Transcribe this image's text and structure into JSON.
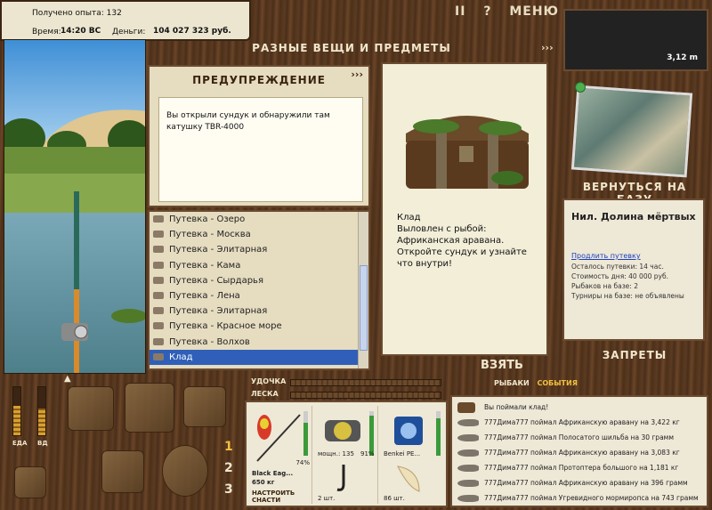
{
  "info": {
    "exp_label": "Получено опыта:",
    "exp_value": "132",
    "time_label": "Время:",
    "time_value": "14:20 ВС",
    "money_label": "Деньги:",
    "money_value": "104 027 323 руб."
  },
  "topbar": {
    "pause": "II",
    "help": "?",
    "menu": "МЕНЮ"
  },
  "depth": "3,12 m",
  "central": {
    "title": "РАЗНЫЕ ВЕЩИ И ПРЕДМЕТЫ",
    "arrows": "›››",
    "warning": {
      "title": "ПРЕДУПРЕЖДЕНИЕ",
      "arrows": "›››",
      "text": "Вы открыли сундук и обнаружили там катушку TBR-4000"
    },
    "list": [
      {
        "label": "Путевка - Озеро"
      },
      {
        "label": "Путевка - Москва"
      },
      {
        "label": "Путевка - Элитарная"
      },
      {
        "label": "Путевка - Кама"
      },
      {
        "label": "Путевка - Сырдарья"
      },
      {
        "label": "Путевка - Лена"
      },
      {
        "label": "Путевка - Элитарная"
      },
      {
        "label": "Путевка - Красное море"
      },
      {
        "label": "Путевка - Волхов"
      },
      {
        "label": "Клад"
      }
    ],
    "selected_index": 9,
    "detail": {
      "name": "Клад",
      "desc": "Выловлен с рыбой: Африканская аравана. Откройте сундук и узнайте что внутри!"
    },
    "take": "ВЗЯТЬ"
  },
  "base": {
    "back": "ВЕРНУТЬСЯ НА БАЗУ",
    "name": "Нил. Долина мёртвых",
    "extend_link": "Продлить путевку",
    "lines": [
      "Осталось путевки: 14 час.",
      "Стоимость дня: 40 000 руб.",
      "Рыбаков на базе: 2",
      "Турниры на базе: не объявлены"
    ],
    "bans": "ЗАПРЕТЫ"
  },
  "gauges": {
    "food_label": "ЕДА",
    "vodka_label": "ВД",
    "food": 0.62,
    "vodka": 0.55
  },
  "tabs": [
    "1",
    "2",
    "3"
  ],
  "active_tab": 0,
  "bars": {
    "rod": "УДОЧКА",
    "line": "ЛЕСКА"
  },
  "panel_tabs": {
    "fishing": "РЫБАКИ",
    "events": "СОБЫТИЯ"
  },
  "tackle": {
    "rod_name": "Black Eag...",
    "rod_weight": "650 кг",
    "rod_pct": "74%",
    "reel_name": "мощн.: 135",
    "reel_pct": "91%",
    "line_name": "Benkei PE...",
    "setup": "НАСТРОИТЬ СНАСТИ",
    "hook_count": "2 шт.",
    "bait_count": "86 шт.",
    "rod_level": 0.74,
    "reel_level": 0.91,
    "line_level": 0.85
  },
  "feed": [
    {
      "icon": "chest-icon",
      "text": "Вы поймали клад!"
    },
    {
      "icon": "fish-icon",
      "text": "777Дима777 поймал Африканскую аравану на 3,422 кг"
    },
    {
      "icon": "fish-icon",
      "text": "777Дима777 поймал Полосатого шильба на 30 грамм"
    },
    {
      "icon": "fish-icon",
      "text": "777Дима777 поймал Африканскую аравану на 3,083 кг"
    },
    {
      "icon": "fish-icon",
      "text": "777Дима777 поймал Протоптера большого на 1,181 кг"
    },
    {
      "icon": "fish-icon",
      "text": "777Дима777 поймал Африканскую аравану на 396 грамм"
    },
    {
      "icon": "fish-icon",
      "text": "777Дима777 поймал Угревидного мормиропса на 743 грамм"
    }
  ]
}
